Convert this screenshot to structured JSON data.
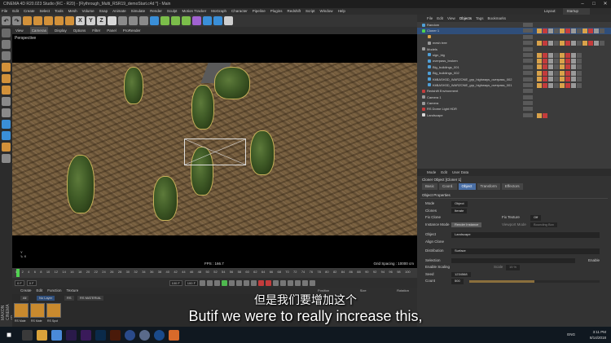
{
  "window": {
    "title": "CINEMA 4D R20.023 Studio (RC - R20) - [Flythrough_Multi_RSR19_demoStart.c4d *] - Main"
  },
  "menubar": {
    "items": [
      "File",
      "Edit",
      "Create",
      "Select",
      "Tools",
      "Mesh",
      "Volume",
      "Snap",
      "Animate",
      "Simulate",
      "Render",
      "Sculpt",
      "Motion Tracker",
      "MoGraph",
      "Character",
      "Pipeline",
      "Plugins",
      "Redshift",
      "Script",
      "Window",
      "Help"
    ],
    "layout_label": "Layout:",
    "layout_value": "Startup"
  },
  "viewport": {
    "menu": [
      "View",
      "Cameras",
      "Display",
      "Options",
      "Filter",
      "Panel",
      "ProRender"
    ],
    "label": "Perspective",
    "fps": "FPS : 166.7",
    "grid_spacing": "Grid Spacing : 10000 cm"
  },
  "timeline": {
    "ticks": [
      "0",
      "2",
      "4",
      "6",
      "8",
      "10",
      "12",
      "14",
      "16",
      "18",
      "20",
      "22",
      "24",
      "26",
      "28",
      "30",
      "32",
      "34",
      "36",
      "38",
      "40",
      "42",
      "44",
      "46",
      "48",
      "50",
      "52",
      "54",
      "56",
      "58",
      "60",
      "62",
      "64",
      "66",
      "68",
      "70",
      "72",
      "74",
      "76",
      "78",
      "80",
      "82",
      "84",
      "86",
      "88",
      "90",
      "92",
      "94",
      "96",
      "98",
      "100"
    ],
    "current_frame": "0 F",
    "start_field": "0 F",
    "end_field": "100 F",
    "end_field2": "100 F"
  },
  "materials": {
    "menu": [
      "Create",
      "Edit",
      "Function",
      "Texture"
    ],
    "chips": [
      "All",
      "No Layer",
      "RS",
      "RS MATERIAL"
    ],
    "items": [
      {
        "label": "RS Mate"
      },
      {
        "label": "RS Mate"
      },
      {
        "label": "RS Spot"
      }
    ]
  },
  "coords": {
    "headers": [
      "Position",
      "Size",
      "Rotation"
    ]
  },
  "objects": {
    "menu": [
      "File",
      "Edit",
      "View",
      "Objects",
      "Tags",
      "Bookmarks"
    ],
    "rows": [
      {
        "name": "Random",
        "indent": 0,
        "color": "#4fa0d8",
        "highlight": false
      },
      {
        "name": "Cloner 1",
        "indent": 0,
        "color": "#4fd24f",
        "highlight": true
      },
      {
        "name": "",
        "indent": 1,
        "color": "#d9a24a",
        "highlight": false
      },
      {
        "name": "mesh tree",
        "indent": 1,
        "color": "#9a9a9a",
        "highlight": false
      },
      {
        "name": "Models",
        "indent": 0,
        "color": "#9a9a9a",
        "highlight": false
      },
      {
        "name": "sign_big",
        "indent": 1,
        "color": "#4fa0d8",
        "highlight": false
      },
      {
        "name": "overpass_broken",
        "indent": 1,
        "color": "#4fa0d8",
        "highlight": false
      },
      {
        "name": "Big_buildings_001",
        "indent": 1,
        "color": "#4fa0d8",
        "highlight": false
      },
      {
        "name": "Big_buildings_002",
        "indent": 1,
        "color": "#4fa0d8",
        "highlight": false
      },
      {
        "name": "KitBASH3D_WARZONE_grp_highways_overpass_002",
        "indent": 1,
        "color": "#4fa0d8",
        "highlight": false
      },
      {
        "name": "KitBASH3D_WARZONE_grp_highways_overpass_001",
        "indent": 1,
        "color": "#4fa0d8",
        "highlight": false
      },
      {
        "name": "Redshift Environment",
        "indent": 0,
        "color": "#c43c3c",
        "highlight": false
      },
      {
        "name": "Camera 1",
        "indent": 0,
        "color": "#9a9a9a",
        "highlight": false
      },
      {
        "name": "Camera",
        "indent": 0,
        "color": "#9a9a9a",
        "highlight": false
      },
      {
        "name": "RS Dome Light HDR",
        "indent": 0,
        "color": "#c43c3c",
        "highlight": false
      },
      {
        "name": "Landscape",
        "indent": 0,
        "color": "#d8d8d8",
        "highlight": false
      }
    ]
  },
  "attributes": {
    "menu": [
      "Mode",
      "Edit",
      "User Data"
    ],
    "title": "Cloner Object [Cloner 1]",
    "tabs": [
      "Basic",
      "Coord.",
      "Object",
      "Transform",
      "Effectors"
    ],
    "active_tab": "Object",
    "section": "Object Properties",
    "mode_label": "Mode",
    "mode_value": "Object",
    "clones_label": "Clones",
    "clones_value": "Iterate",
    "fix_clone_label": "Fix Clone",
    "fix_texture_label": "Fix Texture",
    "fix_texture_value": "Off",
    "instance_mode_label": "Instance Mode",
    "instance_mode_value": "Render Instance",
    "viewport_mode_label": "Viewport Mode",
    "viewport_mode_value": "Bounding Box",
    "object_label": "Object",
    "object_value": "Landscape",
    "align_clone_label": "Align Clone",
    "distribution_label": "Distribution",
    "distribution_value": "Surface",
    "selection_label": "Selection",
    "enable_label": "Enable",
    "enable_scaling_label": "Enable Scaling",
    "scale_label": "Scale",
    "scale_value": "15 %",
    "seed_label": "Seed",
    "seed_value": "1234568",
    "count_label": "Count",
    "count_value": "500",
    "count_fraction": 0.5
  },
  "subtitle": {
    "zh": "但是我们要增加这个",
    "en": "Butif we were to really increase this,"
  },
  "taskbar": {
    "ime": "ENG",
    "time": "3:11 PM",
    "date": "8/14/2018"
  }
}
